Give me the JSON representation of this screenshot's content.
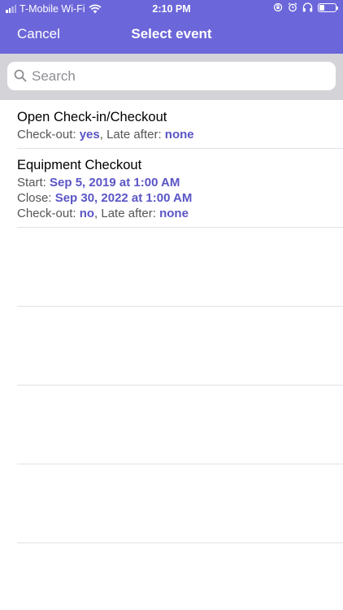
{
  "status_bar": {
    "carrier": "T-Mobile Wi-Fi",
    "time": "2:10 PM"
  },
  "nav": {
    "cancel_label": "Cancel",
    "title": "Select event"
  },
  "search": {
    "placeholder": "Search",
    "value": ""
  },
  "events": [
    {
      "title": "Open Check-in/Checkout",
      "checkout_label": "Check-out: ",
      "checkout_value": "yes",
      "late_label": ", Late after: ",
      "late_value": "none"
    },
    {
      "title": "Equipment Checkout",
      "start_label": "Start: ",
      "start_value": "Sep 5, 2019 at 1:00 AM",
      "close_label": "Close: ",
      "close_value": "Sep 30, 2022 at 1:00 AM",
      "checkout_label": "Check-out: ",
      "checkout_value": "no",
      "late_label": ", Late after: ",
      "late_value": "none"
    }
  ],
  "colors": {
    "header": "#6b66d9",
    "accent_value": "#5a55c6"
  }
}
